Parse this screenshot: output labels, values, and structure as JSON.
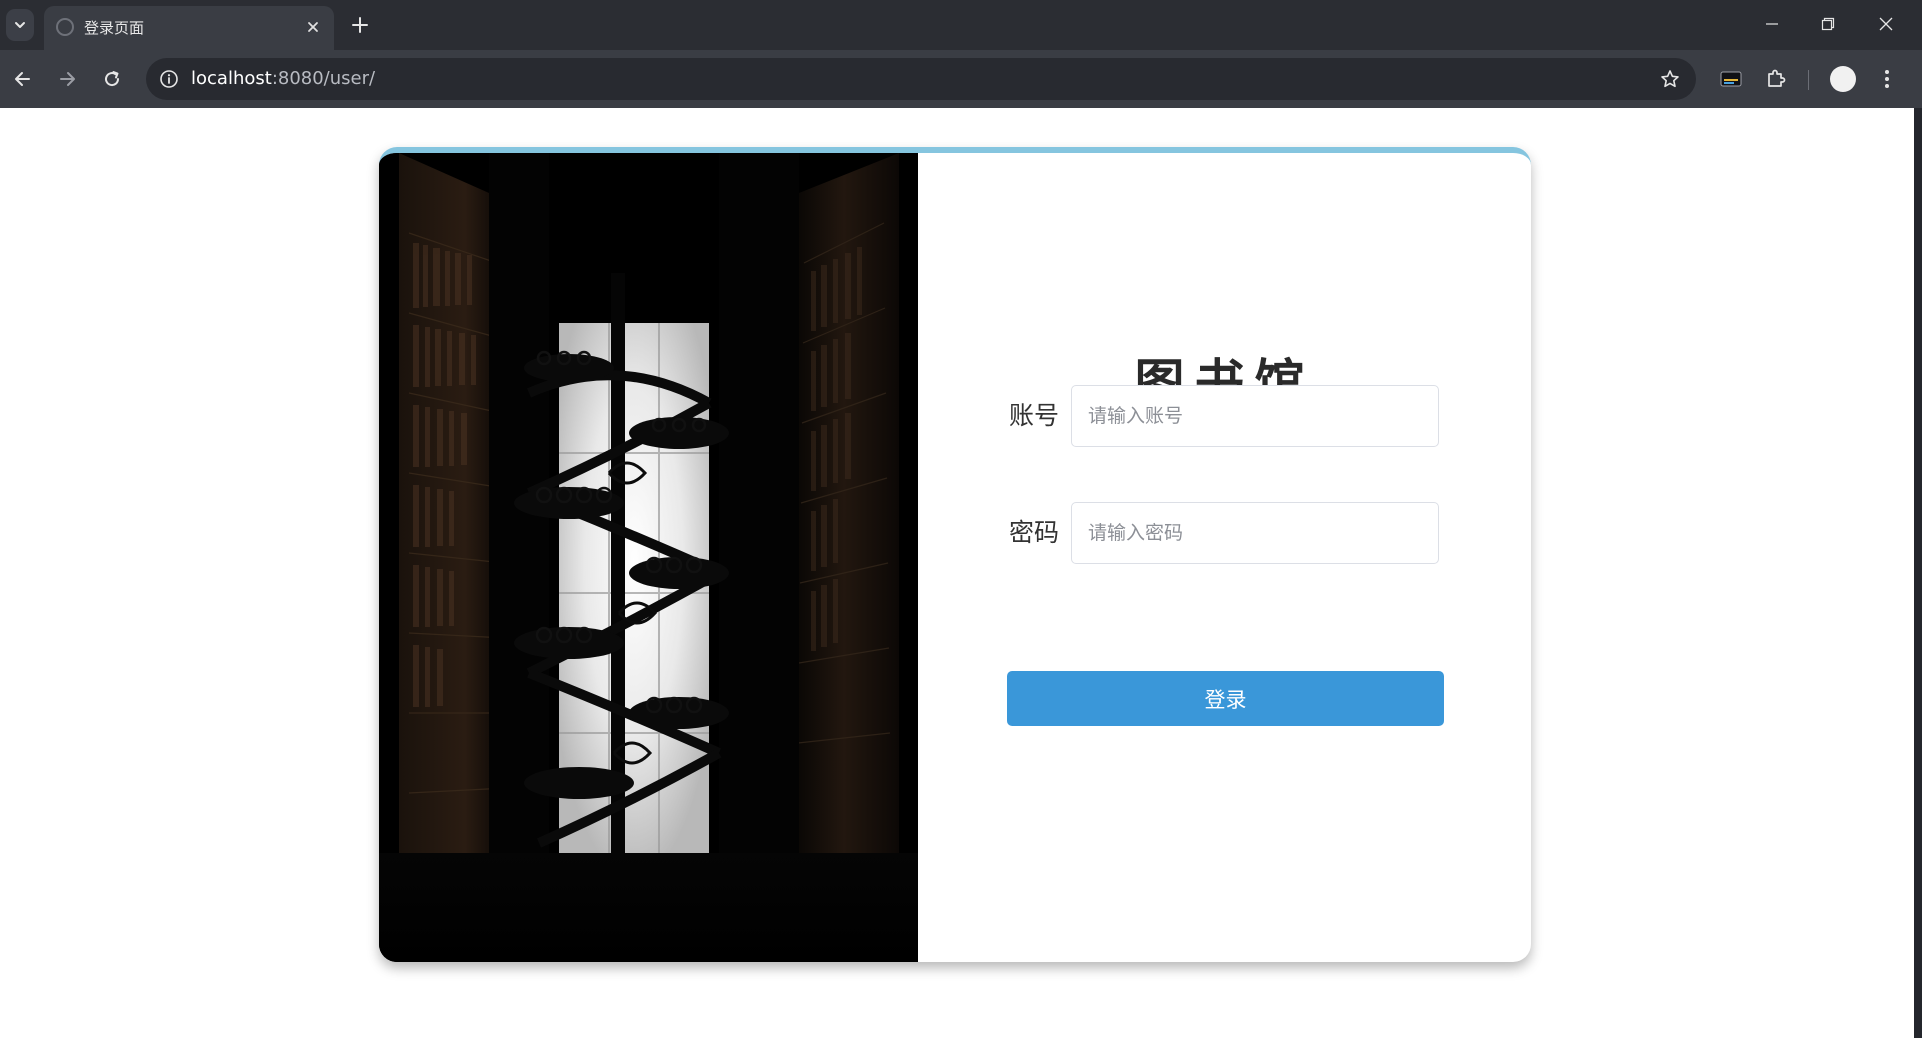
{
  "browser": {
    "tab": {
      "title": "登录页面"
    },
    "new_tab_label": "+",
    "address_bar": {
      "host": "localhost",
      "path": ":8080/user/"
    },
    "icons": {
      "tab_menu": "chevron-down-icon",
      "tab_close": "close-icon",
      "new_tab": "plus-icon",
      "back": "arrow-left-icon",
      "forward": "arrow-right-icon",
      "reload": "reload-icon",
      "site_info": "info-icon",
      "bookmark": "star-icon",
      "extension": "puzzle-icon",
      "menu": "kebab-menu-icon"
    },
    "colors": {
      "frame": "#2b2d33",
      "toolbar": "#3a3d44",
      "omnibox": "#282a30"
    }
  },
  "login": {
    "title": "图书馆",
    "account": {
      "label": "账号",
      "placeholder": "请输入账号",
      "value": ""
    },
    "password": {
      "label": "密码",
      "placeholder": "请输入密码",
      "value": ""
    },
    "submit_label": "登录",
    "colors": {
      "accent_top_border": "#85c5df",
      "button": "#3a97d9",
      "photo_background": "#000000"
    }
  }
}
